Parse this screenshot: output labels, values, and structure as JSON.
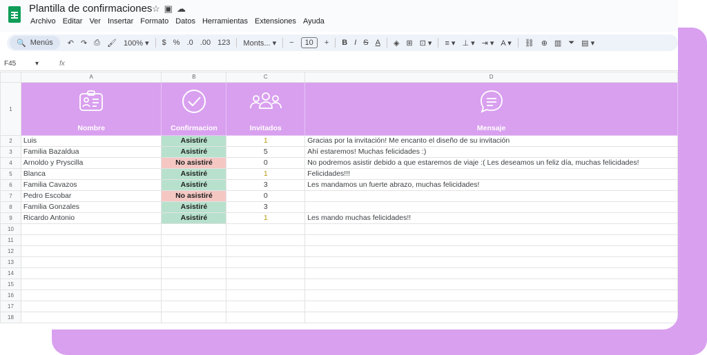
{
  "app": {
    "doc_title": "Plantilla de confirmaciones",
    "menu": [
      "Archivo",
      "Editar",
      "Ver",
      "Insertar",
      "Formato",
      "Datos",
      "Herramientas",
      "Extensiones",
      "Ayuda"
    ]
  },
  "toolbar": {
    "search_label": "Menús",
    "zoom": "100%",
    "currency": "$",
    "percent": "%",
    "dec_decrease": ".0",
    "dec_increase": ".00",
    "number_format": "123",
    "font": "Monts...",
    "minus": "−",
    "font_size": "10",
    "plus": "+",
    "bold": "B",
    "italic": "I",
    "strike": "S",
    "text_color": "A"
  },
  "formula_bar": {
    "cell_ref": "F45",
    "fx": "fx"
  },
  "columns": [
    "A",
    "B",
    "C",
    "D"
  ],
  "header": {
    "row_num": "1",
    "nombre": "Nombre",
    "confirmacion": "Confirmacion",
    "invitados": "Invitados",
    "mensaje": "Mensaje"
  },
  "rows": [
    {
      "n": "2",
      "name": "Luis",
      "conf": "Asistiré",
      "status": "yes",
      "inv": "1",
      "gold": true,
      "msg": "Gracias por la invitación! Me encanto el diseño de su invitación"
    },
    {
      "n": "3",
      "name": "Familia Bazaldua",
      "conf": "Asistiré",
      "status": "yes",
      "inv": "5",
      "gold": false,
      "msg": "Ahí estaremos! Muchas felicidades :)"
    },
    {
      "n": "4",
      "name": "Arnoldo y Pryscilla",
      "conf": "No asistiré",
      "status": "no",
      "inv": "0",
      "gold": false,
      "msg": "No podremos asistir debido a que estaremos de viaje :(  Les deseamos un feliz día, muchas felicidades!"
    },
    {
      "n": "5",
      "name": "Blanca",
      "conf": "Asistiré",
      "status": "yes",
      "inv": "1",
      "gold": true,
      "msg": "Felicidades!!!"
    },
    {
      "n": "6",
      "name": "Familia Cavazos",
      "conf": "Asistiré",
      "status": "yes",
      "inv": "3",
      "gold": false,
      "msg": "Les mandamos un fuerte abrazo, muchas felicidades!"
    },
    {
      "n": "7",
      "name": "Pedro Escobar",
      "conf": "No asistiré",
      "status": "no",
      "inv": "0",
      "gold": false,
      "msg": ""
    },
    {
      "n": "8",
      "name": "Familia Gonzales",
      "conf": "Asistiré",
      "status": "yes",
      "inv": "3",
      "gold": false,
      "msg": ""
    },
    {
      "n": "9",
      "name": "Ricardo Antonio",
      "conf": "Asistiré",
      "status": "yes",
      "inv": "1",
      "gold": true,
      "msg": "Les mando muchas felicidades!!"
    }
  ],
  "empty_rows": [
    "10",
    "11",
    "12",
    "13",
    "14",
    "15",
    "16",
    "17",
    "18"
  ],
  "colors": {
    "accent": "#d9a0ef",
    "yes": "#b7e1cd",
    "no": "#f4c7c3",
    "sheets_green": "#0f9d58"
  }
}
